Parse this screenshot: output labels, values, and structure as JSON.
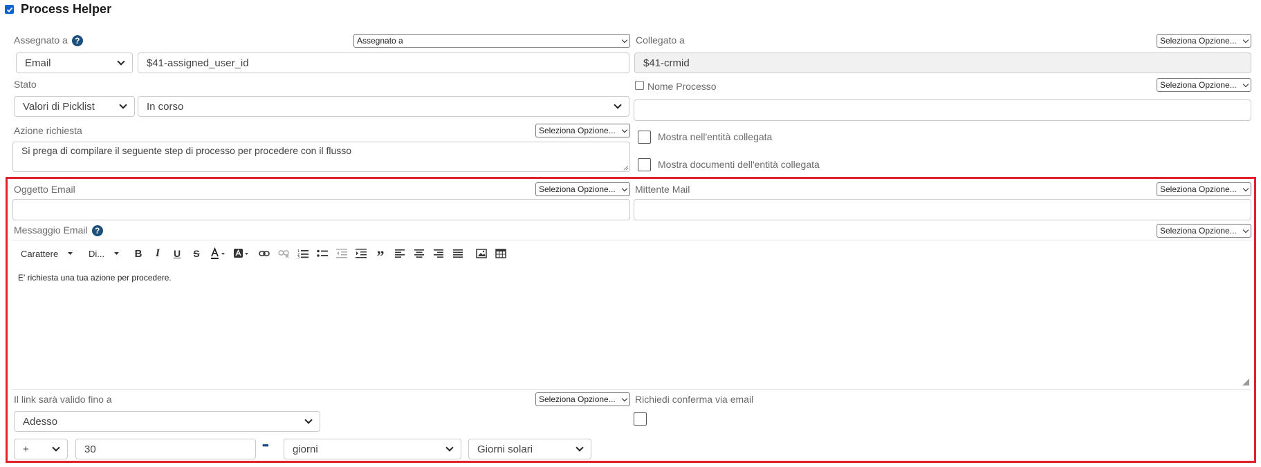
{
  "header": {
    "title": "Process Helper",
    "enabled": true
  },
  "assegnato": {
    "label": "Assegnato a",
    "mode_select": "Assegnato a",
    "type_select": "Email",
    "value": "$41-assigned_user_id"
  },
  "collegato": {
    "label": "Collegato a",
    "option_select": "Seleziona Opzione...",
    "value": "$41-crmid"
  },
  "stato": {
    "label": "Stato",
    "type_select": "Valori di Picklist",
    "value_select": "In corso"
  },
  "nome_processo": {
    "label": "Nome Processo",
    "option_select": "Seleziona Opzione...",
    "value": ""
  },
  "azione": {
    "label": "Azione richiesta",
    "option_select": "Seleziona Opzione...",
    "value": "Si prega di compilare il seguente step di processo per procedere con il flusso"
  },
  "checks": {
    "mostra_entita": "Mostra nell'entità collegata",
    "mostra_documenti": "Mostra documenti dell'entità collegata"
  },
  "oggetto": {
    "label": "Oggetto Email",
    "option_select": "Seleziona Opzione...",
    "value": ""
  },
  "mittente": {
    "label": "Mittente Mail",
    "option_select": "Seleziona Opzione...",
    "value": ""
  },
  "messaggio": {
    "label": "Messaggio Email",
    "option_select": "Seleziona Opzione...",
    "font_select": "Carattere",
    "size_select": "Di...",
    "body": "E' richiesta una tua azione per procedere."
  },
  "link_validita": {
    "label": "Il link sarà valido fino a",
    "option_select": "Seleziona Opzione...",
    "base_select": "Adesso",
    "operator_select": "+",
    "amount": "30",
    "more_label": "•••",
    "unit_select": "giorni",
    "days_type_select": "Giorni solari"
  },
  "conferma": {
    "label": "Richiedi conferma via email"
  },
  "icons": {
    "help": "question-circle-icon",
    "toolbar": [
      "bold-icon",
      "italic-icon",
      "underline-icon",
      "strikethrough-icon",
      "text-color-icon",
      "background-color-icon",
      "link-icon",
      "unlink-icon",
      "numbered-list-icon",
      "bullet-list-icon",
      "outdent-icon",
      "indent-icon",
      "blockquote-icon",
      "align-left-icon",
      "align-center-icon",
      "align-right-icon",
      "justify-icon",
      "image-icon",
      "table-icon"
    ]
  },
  "colors": {
    "highlight_border": "#e0202a",
    "help_icon": "#1d4f7c",
    "checkbox_checked": "#0b63d1"
  }
}
